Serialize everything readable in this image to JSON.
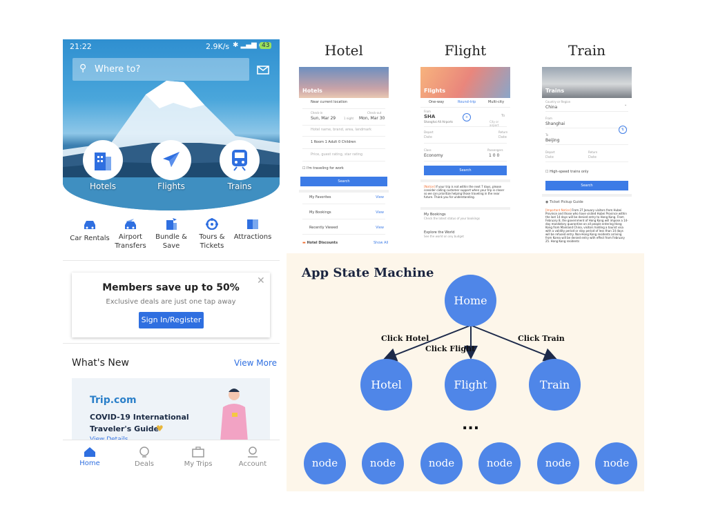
{
  "phone": {
    "status": {
      "time": "21:22",
      "info": "2.9K/s",
      "battery": "43"
    },
    "search_placeholder": "Where to?",
    "hero_items": [
      {
        "label": "Hotels",
        "icon": "hotel-icon"
      },
      {
        "label": "Flights",
        "icon": "plane-icon"
      },
      {
        "label": "Trains",
        "icon": "train-icon"
      }
    ],
    "categories": [
      {
        "line1": "Car Rentals",
        "line2": "",
        "icon": "car-icon"
      },
      {
        "line1": "Airport",
        "line2": "Transfers",
        "icon": "airport-transfer-icon"
      },
      {
        "line1": "Bundle &",
        "line2": "Save",
        "icon": "bundle-icon"
      },
      {
        "line1": "Tours &",
        "line2": "Tickets",
        "icon": "tours-icon"
      },
      {
        "line1": "Attractions",
        "line2": "",
        "icon": "attractions-icon"
      }
    ],
    "members": {
      "title": "Members save up to 50%",
      "subtitle": "Exclusive deals are just one tap away",
      "button": "Sign In/Register"
    },
    "whats_new": {
      "title": "What's New",
      "link": "View More"
    },
    "promo": {
      "brand": "Trip.com",
      "line1": "COVID-19 International",
      "line2": "Traveler's Guide",
      "link": "View Details"
    },
    "tabs": [
      {
        "label": "Home",
        "icon": "home-icon",
        "active": true
      },
      {
        "label": "Deals",
        "icon": "deals-icon",
        "active": false
      },
      {
        "label": "My Trips",
        "icon": "trips-icon",
        "active": false
      },
      {
        "label": "Account",
        "icon": "account-icon",
        "active": false
      }
    ]
  },
  "screens": {
    "hotel": {
      "title": "Hotel",
      "header": "Hotels",
      "near": "Near current location",
      "checkin_lbl": "Check-in",
      "checkin": "Sun, Mar 29",
      "nights": "1 night",
      "checkout_lbl": "Check-out",
      "checkout": "Mon, Mar 30",
      "keyword": "Hotel name, brand, area, landmark",
      "guests": "1 Room  1 Adult  0 Children",
      "price": "Price, guest rating, star rating",
      "work": "I'm traveling for work",
      "search": "Search",
      "favorites": "My Favorites",
      "bookings": "My Bookings",
      "viewed": "Recently Viewed",
      "discounts": "Hotel Discounts",
      "view": "View",
      "show_all": "Show All"
    },
    "flight": {
      "title": "Flight",
      "header": "Flights",
      "trip_types": [
        "One-way",
        "Round-trip",
        "Multi-city"
      ],
      "from_lbl": "From",
      "from": "SHA",
      "from_sub": "Shanghai All Airports",
      "to_lbl": "To",
      "to_sub": "City or airport",
      "depart_lbl": "Depart",
      "return_lbl": "Return",
      "date": "Date",
      "class_lbl": "Class",
      "class": "Economy",
      "passengers_lbl": "Passengers",
      "passengers": "1  0  0",
      "search": "Search",
      "notice_tag": "[Notice]",
      "notice": "If your trip is not within the next 7 days, please consider calling customer support when your trip is closer so we can prioritize helping those traveling in the near future. Thank you for understanding.",
      "bookings": "My Bookings",
      "bookings_sub": "Check the latest status of your bookings",
      "explore": "Explore the World",
      "explore_sub": "See the world on any budget"
    },
    "train": {
      "title": "Train",
      "header": "Trains",
      "country_lbl": "Country or Region",
      "country": "China",
      "from_lbl": "From",
      "from": "Shanghai",
      "to_lbl": "To",
      "to": "Beijing",
      "depart_lbl": "Depart",
      "return_lbl": "Return",
      "date": "Date",
      "highspeed": "High-speed trains only",
      "search": "Search",
      "guide": "Ticket Pickup Guide",
      "notice_tag": "[Important Notice]",
      "notice": "From 27 January visitors from Hubei Province and those who have visited Hubei Province within the last 14 days will be denied entry to Hong Kong. From February 8, the government of Hong Kong will impose a 14-day mandatory quarantine on all people entering Hong Kong from Mainland China, visitors holding a tourist visa with a validity period or stay period of less than 14 days will be refused entry. Non-Hong Kong residents arriving from Korea will be denied entry with effect from February 25. Hong Kong residents"
    }
  },
  "state_machine": {
    "title": "App State Machine",
    "root": "Home",
    "children": [
      "Hotel",
      "Flight",
      "Train"
    ],
    "edges": [
      "Click Hotel",
      "Click Flight",
      "Click Train"
    ],
    "ellipsis": "...",
    "leaves": [
      "node",
      "node",
      "node",
      "node",
      "node",
      "node"
    ]
  },
  "colors": {
    "accent": "#2f6fe0",
    "node": "#4f86e8",
    "panel_bg": "#fdf6ea"
  }
}
